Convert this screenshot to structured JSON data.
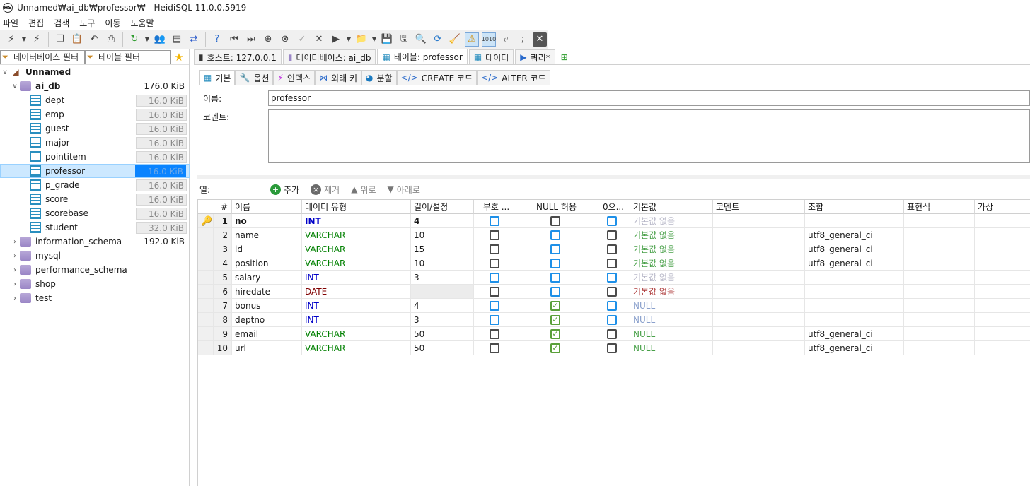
{
  "window": {
    "title": "Unnamed₩ai_db₩professor₩ - HeidiSQL 11.0.0.5919",
    "app_icon": "HS"
  },
  "menu": [
    "파일",
    "편집",
    "검색",
    "도구",
    "이동",
    "도움말"
  ],
  "filters": {
    "database_filter": "데이터베이스 필터",
    "table_filter": "테이블 필터"
  },
  "tree": {
    "server": "Unnamed",
    "database": {
      "name": "ai_db",
      "size": "176.0 KiB"
    },
    "tables": [
      {
        "name": "dept",
        "size": "16.0 KiB"
      },
      {
        "name": "emp",
        "size": "16.0 KiB"
      },
      {
        "name": "guest",
        "size": "16.0 KiB"
      },
      {
        "name": "major",
        "size": "16.0 KiB"
      },
      {
        "name": "pointitem",
        "size": "16.0 KiB"
      },
      {
        "name": "professor",
        "size": "16.0 KiB"
      },
      {
        "name": "p_grade",
        "size": "16.0 KiB"
      },
      {
        "name": "score",
        "size": "16.0 KiB"
      },
      {
        "name": "scorebase",
        "size": "16.0 KiB"
      },
      {
        "name": "student",
        "size": "32.0 KiB"
      }
    ],
    "other_dbs": [
      {
        "name": "information_schema",
        "size": "192.0 KiB"
      },
      {
        "name": "mysql",
        "size": ""
      },
      {
        "name": "performance_schema",
        "size": ""
      },
      {
        "name": "shop",
        "size": ""
      },
      {
        "name": "test",
        "size": ""
      }
    ]
  },
  "main_tabs": [
    {
      "label": "호스트: 127.0.0.1"
    },
    {
      "label": "데이터베이스: ai_db"
    },
    {
      "label": "테이블: professor"
    },
    {
      "label": "데이터"
    },
    {
      "label": "쿼리*"
    }
  ],
  "sub_tabs": [
    "기본",
    "옵션",
    "인덱스",
    "외래 키",
    "분할",
    "CREATE 코드",
    "ALTER 코드"
  ],
  "form": {
    "name_label": "이름:",
    "name_value": "professor",
    "comment_label": "코멘트:"
  },
  "columns_bar": {
    "label": "열:",
    "add": "추가",
    "remove": "제거",
    "up": "위로",
    "down": "아래로"
  },
  "grid": {
    "headers": [
      "#",
      "이름",
      "데이터 유형",
      "길이/설정",
      "부호 ...",
      "NULL 허용",
      "0으...",
      "기본값",
      "코멘트",
      "조합",
      "표현식",
      "가상"
    ],
    "rows": [
      {
        "n": "1",
        "name": "no",
        "type": "INT",
        "len": "4",
        "def": "기본값 없음",
        "coll": ""
      },
      {
        "n": "2",
        "name": "name",
        "type": "VARCHAR",
        "len": "10",
        "def": "기본값 없음",
        "coll": "utf8_general_ci"
      },
      {
        "n": "3",
        "name": "id",
        "type": "VARCHAR",
        "len": "15",
        "def": "기본값 없음",
        "coll": "utf8_general_ci"
      },
      {
        "n": "4",
        "name": "position",
        "type": "VARCHAR",
        "len": "10",
        "def": "기본값 없음",
        "coll": "utf8_general_ci"
      },
      {
        "n": "5",
        "name": "salary",
        "type": "INT",
        "len": "3",
        "def": "기본값 없음",
        "coll": ""
      },
      {
        "n": "6",
        "name": "hiredate",
        "type": "DATE",
        "len": "",
        "def": "기본값 없음",
        "coll": ""
      },
      {
        "n": "7",
        "name": "bonus",
        "type": "INT",
        "len": "4",
        "def": "NULL",
        "coll": ""
      },
      {
        "n": "8",
        "name": "deptno",
        "type": "INT",
        "len": "3",
        "def": "NULL",
        "coll": ""
      },
      {
        "n": "9",
        "name": "email",
        "type": "VARCHAR",
        "len": "50",
        "def": "NULL",
        "coll": "utf8_general_ci"
      },
      {
        "n": "10",
        "name": "url",
        "type": "VARCHAR",
        "len": "50",
        "def": "NULL",
        "coll": "utf8_general_ci"
      }
    ]
  },
  "colors": {
    "accent": "#0a84ff",
    "selection": "#cce8ff",
    "int_type": "#0000c8",
    "varchar_type": "#008000",
    "date_type": "#800000"
  }
}
